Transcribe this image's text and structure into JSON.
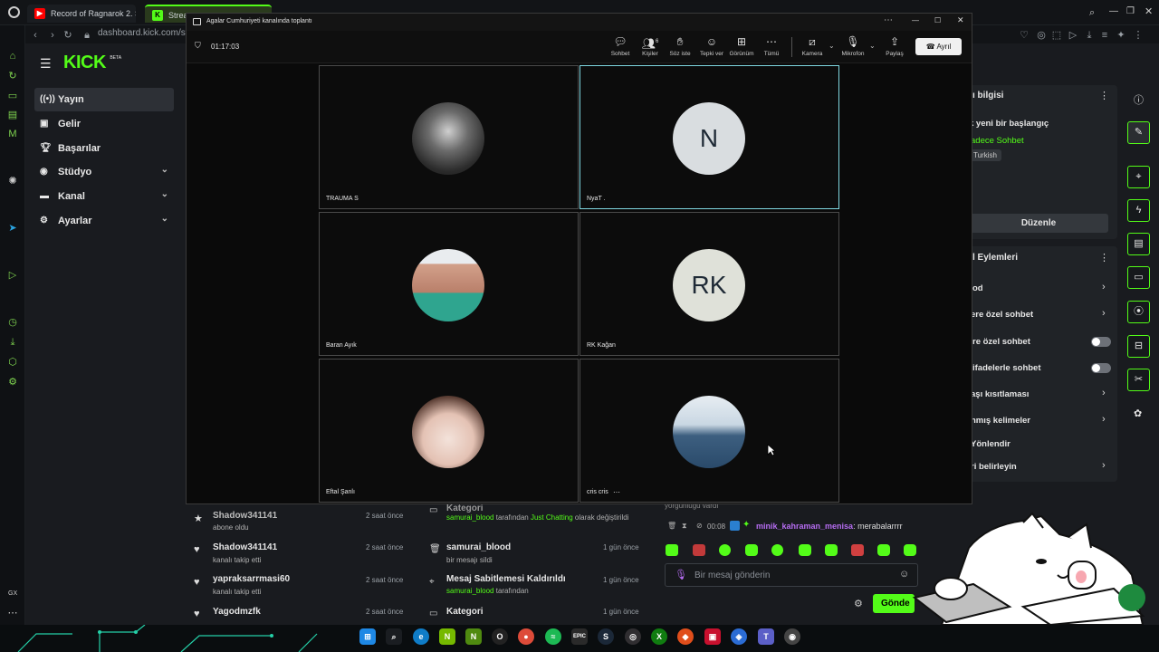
{
  "browser": {
    "tabs": [
      {
        "label": "Record of Ragnarok 2. Se",
        "icon": "youtube-icon",
        "color": "#ff0000"
      },
      {
        "label": "Stream",
        "icon": "kick-icon",
        "color": "#53fc18"
      }
    ],
    "url_host": "dashboard.kick.com",
    "url_path": "/st",
    "left_badge": "GX"
  },
  "kick": {
    "logo": "KICK",
    "logo_badge": "BETA",
    "nav": [
      {
        "label": "Yayın",
        "icon": "broadcast-icon",
        "active": true
      },
      {
        "label": "Gelir",
        "icon": "wallet-icon"
      },
      {
        "label": "Başarılar",
        "icon": "trophy-icon"
      },
      {
        "label": "Stüdyo",
        "icon": "palette-icon",
        "expandable": true
      },
      {
        "label": "Kanal",
        "icon": "channel-icon",
        "expandable": true
      },
      {
        "label": "Ayarlar",
        "icon": "gear-icon",
        "expandable": true
      }
    ],
    "stream_info": {
      "heading": "ı bilgisi",
      "title": "k yeni bir başlangıç",
      "category": "adece Sohbet",
      "language": "Turkish",
      "edit_label": "Düzenle"
    },
    "mod_actions": {
      "heading": "l Eylemleri",
      "items": [
        {
          "label": "od",
          "control": "chevron"
        },
        {
          "label": "ere özel sohbet",
          "control": "chevron"
        },
        {
          "label": "re özel sohbet",
          "control": "toggle"
        },
        {
          "label": "ifadelerle sohbet",
          "control": "toggle"
        },
        {
          "label": "aşı kısıtlaması",
          "control": "chevron"
        },
        {
          "label": "nmış kelimeler",
          "control": "chevron"
        },
        {
          "label": "Yönlendir",
          "control": "none"
        },
        {
          "label": "ri belirleyin",
          "control": "chevron"
        }
      ]
    },
    "recent_events": [
      {
        "title": "Shadow341141",
        "sub": "abone oldu",
        "time": "2 saat önce",
        "icon": "star-icon"
      },
      {
        "title": "Shadow341141",
        "sub": "kanalı takip etti",
        "time": "2 saat önce",
        "icon": "heart-icon"
      },
      {
        "title": "yapraksarrmasi60",
        "sub": "kanalı takip etti",
        "time": "2 saat önce",
        "icon": "heart-icon"
      },
      {
        "title": "Yagodmzfk",
        "sub": "",
        "time": "2 saat önce",
        "icon": "heart-icon"
      }
    ],
    "mod_log": [
      {
        "title": "Kategori",
        "actor": "samurai_blood",
        "mid": "tarafından",
        "target": "Just Chatting",
        "rest": "olarak değiştirildi",
        "time": "",
        "icon": "category-icon"
      },
      {
        "title": "samurai_blood",
        "sub": "bir mesajı sildi",
        "time": "1 gün önce",
        "icon": "trash-icon"
      },
      {
        "title": "Mesaj Sabitlemesi Kaldırıldı",
        "actor": "samurai_blood",
        "mid": "tarafından",
        "time": "1 gün önce",
        "icon": "pin-icon"
      },
      {
        "title": "Kategori",
        "time": "1 gün önce",
        "icon": "category-icon"
      }
    ],
    "chat": {
      "partial_line": "yorgunluğu vardı",
      "timestamp": "00:08",
      "username": "minik_kahraman_menisa",
      "message": "merabalarrrr",
      "input_placeholder": "Bir mesaj gönderin",
      "send_label": "Gönde"
    }
  },
  "teams": {
    "window_title": "Agalar Cumhuriyeti kanalında toplantı",
    "timer": "01:17:03",
    "people_count": "6",
    "toolbar": [
      {
        "label": "Sohbet",
        "icon": "chat-icon"
      },
      {
        "label": "Kişiler",
        "icon": "people-icon"
      },
      {
        "label": "Söz iste",
        "icon": "raise-hand-icon"
      },
      {
        "label": "Tepki ver",
        "icon": "emoji-icon"
      },
      {
        "label": "Görünüm",
        "icon": "grid-icon"
      },
      {
        "label": "Tümü",
        "icon": "more-icon"
      },
      {
        "label": "Kamera",
        "icon": "camera-off-icon"
      },
      {
        "label": "Mikrofon",
        "icon": "microphone-icon"
      },
      {
        "label": "Paylaş",
        "icon": "share-icon"
      }
    ],
    "leave_label": "Ayrıl",
    "participants": [
      {
        "name": "TRAUMA S",
        "avatar": "photo",
        "tone": "#8a8a8a"
      },
      {
        "name": "NyaT .",
        "avatar": "initials",
        "initials": "N",
        "speaking": true
      },
      {
        "name": "Baran Ayık",
        "avatar": "photo",
        "tone": "#2fa58f"
      },
      {
        "name": "RK Kağan",
        "avatar": "initials",
        "initials": "RK"
      },
      {
        "name": "Eftal Şanlı",
        "avatar": "photo",
        "tone": "#e8cfc4"
      },
      {
        "name": "cris cris",
        "avatar": "photo",
        "tone": "#6c8fb0"
      }
    ]
  },
  "colors": {
    "kick_green": "#53fc18",
    "speaker_border": "#7fd6e0"
  }
}
